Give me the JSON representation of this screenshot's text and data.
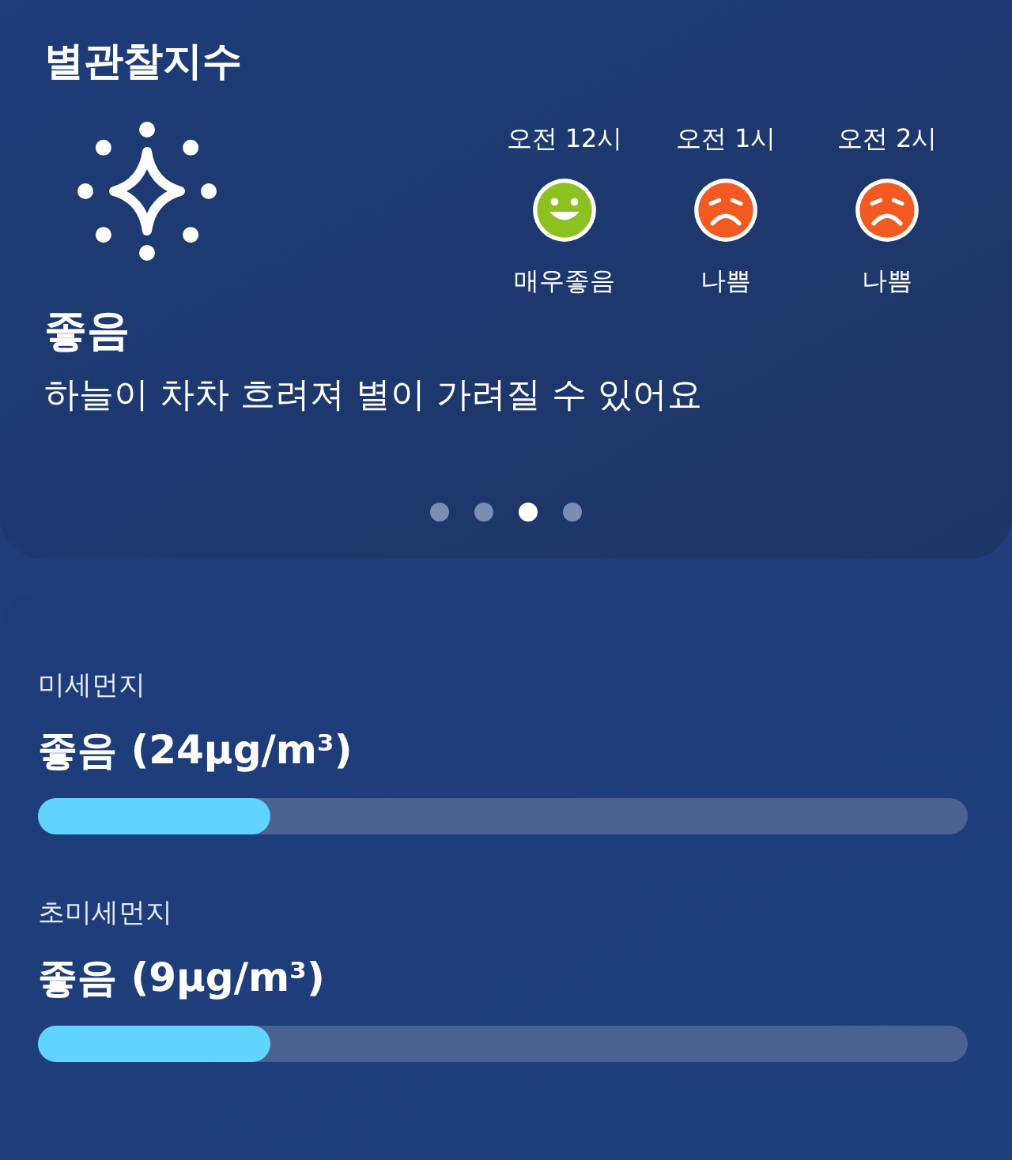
{
  "star_index": {
    "title": "별관찰지수",
    "grade": "좋음",
    "message": "하늘이 차차 흐려져 별이 가려질 수 있어요",
    "forecast": [
      {
        "time": "오전 12시",
        "grade": "매우좋음",
        "kind": "smile",
        "color": "#8cc21f"
      },
      {
        "time": "오전 1시",
        "grade": "나쁨",
        "kind": "frown",
        "color": "#f25a22"
      },
      {
        "time": "오전 2시",
        "grade": "나쁨",
        "kind": "frown",
        "color": "#f25a22"
      }
    ],
    "pages": [
      {
        "selected": false
      },
      {
        "selected": false
      },
      {
        "selected": true
      },
      {
        "selected": false
      }
    ]
  },
  "dust": [
    {
      "label": "미세먼지",
      "value": "좋음 (24µg/m³)",
      "level": 0.25
    },
    {
      "label": "초미세먼지",
      "value": "좋음 (9µg/m³)",
      "level": 0.25
    }
  ]
}
